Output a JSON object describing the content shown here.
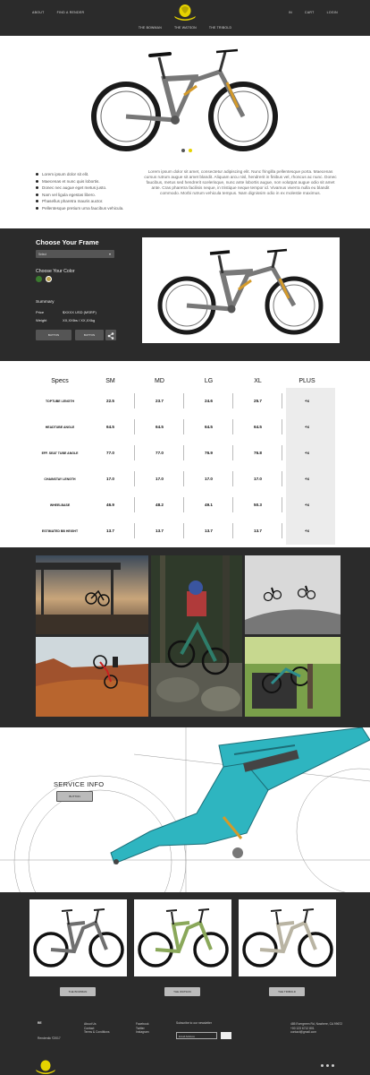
{
  "header": {
    "nav_left": [
      "ABOUT",
      "FIND A RENDER"
    ],
    "nav_right": [
      "IN",
      "CART",
      "LOGIN"
    ],
    "subnav": [
      "THE BOWMAN",
      "THE WATSON",
      "THE TRIBOLD"
    ],
    "brand_color": "#e6d300"
  },
  "hero": {
    "bullets": [
      "Lorem ipsum dolor sit elit.",
      "Maecenas et nunc quis lobortis.",
      "Donec nec augue eget metus justo.",
      "Nam vel ligula egestas libero.",
      "Phasellus pharetra mauris auctor.",
      "Pellentesque pretium urna faucibus vehicula."
    ],
    "paragraph": "Lorem ipsum dolor sit amet, consectetur adipiscing elit. Nunc fringilla pellentesque porta. Maecenas cursus rutrum augue sit amet blandit. Aliquam arcu nisl, hendrerit in finibus vel, rhoncus ac nunc. Donec faucibus, metus sed hendrerit scelerisque, nunc ante lobortis augue, non volutpat augue odio sit amet ante. Cras pharetra facilisis neque, in tristique neque tempor id. Vivamus viverra nulla eu blandit commodo. Morbi rutrum vehicula tempus. Nam dignissim odio in ex molestie maximus.",
    "active_slide": 2,
    "slide_count": 2
  },
  "config": {
    "frame_title": "Choose Your Frame",
    "frame_select": "Select",
    "color_title": "Choose Your Color",
    "colors": [
      "#3a7a2e",
      "#b7a050"
    ],
    "summary_title": "Summary",
    "price_label": "Price",
    "price_value": "$XXXX USD (MSRP)",
    "weight_label": "Weight",
    "weight_value": "XX,XXlbs / XX,XXkg",
    "button1": "BUTTON",
    "button2": "BUTTON"
  },
  "specs": {
    "headers": [
      "Specs",
      "SM",
      "MD",
      "LG",
      "XL",
      "PLUS"
    ],
    "rows": [
      {
        "label": "TOPTUBE LENGTH",
        "values": [
          "22.5",
          "23.7",
          "24.6",
          "25.7",
          "+x"
        ]
      },
      {
        "label": "HEADTUBE ANGLE",
        "values": [
          "64.5",
          "64.5",
          "64.5",
          "64.5",
          "+x"
        ]
      },
      {
        "label": "EFF. SEAT TUBE ANGLE",
        "values": [
          "77.0",
          "77.0",
          "76.9",
          "76.8",
          "+x"
        ]
      },
      {
        "label": "CHAINSTAY LENGTH",
        "values": [
          "17.0",
          "17.0",
          "17.0",
          "17.0",
          "+x"
        ]
      },
      {
        "label": "WHEELBASE",
        "values": [
          "46.9",
          "48.2",
          "49.1",
          "50.3",
          "+x"
        ]
      },
      {
        "label": "ESTIMATED BB HEIGHT",
        "values": [
          "13.7",
          "13.7",
          "13.7",
          "13.7",
          "+x"
        ]
      }
    ]
  },
  "service": {
    "title": "SERVICE INFO",
    "button": "BUTTON"
  },
  "models": [
    {
      "button": "THE BOWMAN",
      "color": "#6f6f6f"
    },
    {
      "button": "THE WATSON",
      "color": "#8aa85a"
    },
    {
      "button": "THE TRIBOLD",
      "color": "#b9b4a3"
    }
  ],
  "footer": {
    "brand": "RE",
    "copyright": "Renderdic ©2017",
    "col1": [
      "About Us",
      "Contact",
      "Terms & Conditions"
    ],
    "col2": [
      "Facebook",
      "Twitter",
      "Instagram"
    ],
    "newsletter_title": "Subscribe to our newsletter",
    "newsletter_placeholder": "Email Address",
    "address": [
      "485 Evergreen Rd, Nowhere, CA 99672",
      "+00 123 6712 801",
      "contact@gmail.com"
    ]
  }
}
